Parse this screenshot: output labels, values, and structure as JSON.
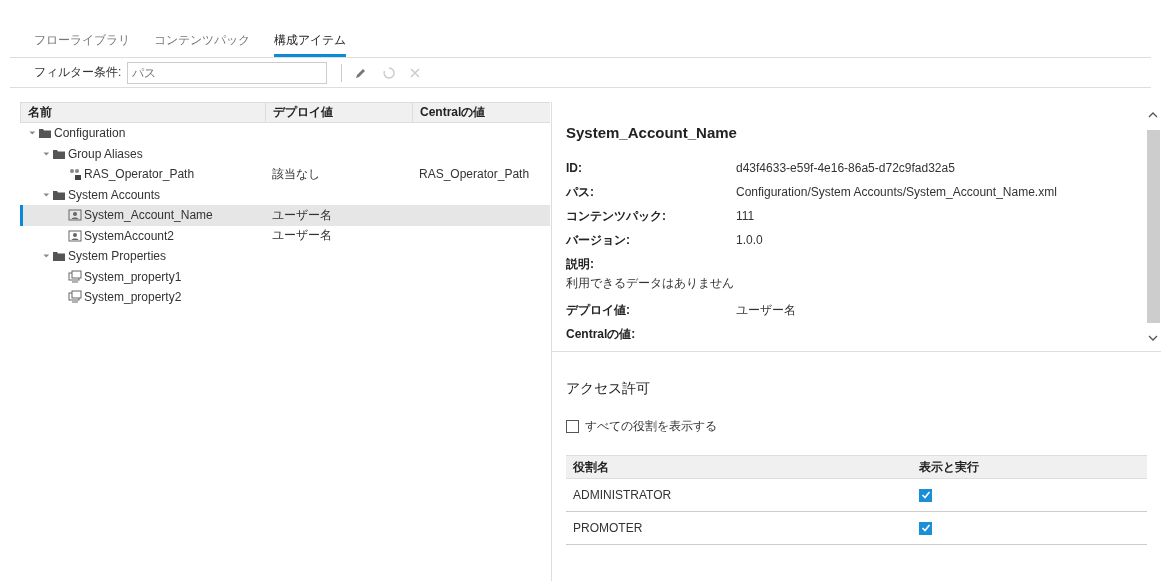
{
  "tabs": [
    {
      "label": "フローライブラリ",
      "selected": false
    },
    {
      "label": "コンテンツパック",
      "selected": false
    },
    {
      "label": "構成アイテム",
      "selected": true
    }
  ],
  "filter": {
    "label": "フィルター条件:",
    "placeholder": "パス"
  },
  "tree": {
    "columns": [
      "名前",
      "デプロイ値",
      "Centralの値"
    ],
    "items": [
      {
        "kind": "folder",
        "name": "Configuration",
        "expanded": true,
        "selected": false,
        "children": [
          {
            "kind": "folder",
            "name": "Group Aliases",
            "expanded": true,
            "selected": false,
            "children": [
              {
                "kind": "alias",
                "name": "RAS_Operator_Path",
                "deploy": "該当なし",
                "central": "RAS_Operator_Path",
                "selected": false
              }
            ]
          },
          {
            "kind": "folder",
            "name": "System Accounts",
            "expanded": true,
            "selected": false,
            "children": [
              {
                "kind": "account",
                "name": "System_Account_Name",
                "deploy": "ユーザー名",
                "selected": true
              },
              {
                "kind": "account",
                "name": "SystemAccount2",
                "deploy": "ユーザー名",
                "selected": false
              }
            ]
          },
          {
            "kind": "folder",
            "name": "System Properties",
            "expanded": true,
            "selected": false,
            "children": [
              {
                "kind": "property",
                "name": "System_property1",
                "selected": false
              },
              {
                "kind": "property",
                "name": "System_property2",
                "selected": false
              }
            ]
          }
        ]
      }
    ]
  },
  "details": {
    "title": "System_Account_Name",
    "fields": [
      {
        "label": "ID:",
        "value": "d43f4633-e59f-4e16-86a5-d72c9fad32a5"
      },
      {
        "label": "パス:",
        "value": "Configuration/System Accounts/System_Account_Name.xml"
      },
      {
        "label": "コンテンツパック:",
        "value": "111"
      },
      {
        "label": "バージョン:",
        "value": "1.0.0"
      }
    ],
    "description": {
      "label": "説明:",
      "value": "利用できるデータはありません"
    },
    "values": [
      {
        "label": "デプロイ値:",
        "value": "ユーザー名"
      },
      {
        "label": "Centralの値:"
      }
    ]
  },
  "permissions": {
    "title": "アクセス許可",
    "show_all": {
      "label": "すべての役割を表示する",
      "checked": false
    },
    "columns": [
      "役割名",
      "表示と実行"
    ],
    "rows": [
      {
        "role": "ADMINISTRATOR",
        "checked": true
      },
      {
        "role": "PROMOTER",
        "checked": true
      }
    ]
  }
}
